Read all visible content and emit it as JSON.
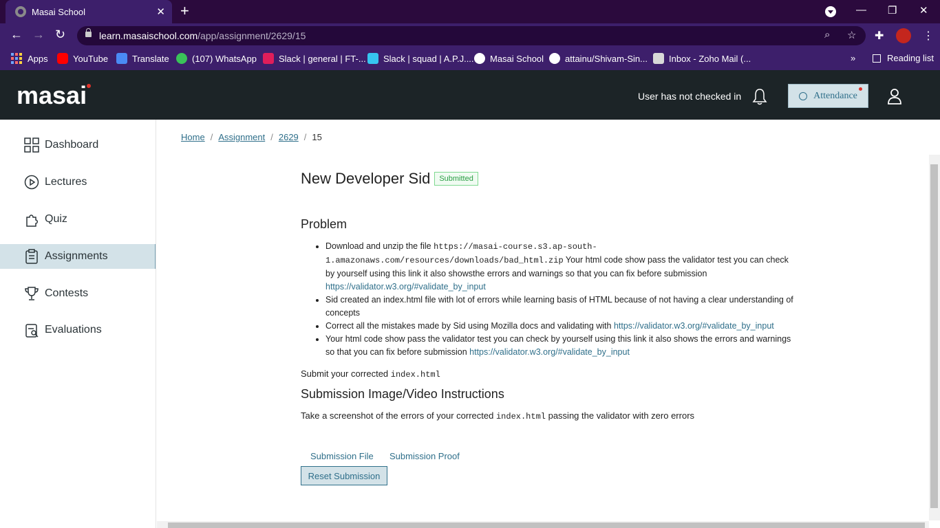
{
  "browser": {
    "tab_title": "Masai School",
    "url_host": "learn.masaischool.com",
    "url_path": "/app/assignment/2629/15",
    "bookmarks": [
      "Apps",
      "YouTube",
      "Translate",
      "(107) WhatsApp",
      "Slack | general | FT-...",
      "Slack | squad | A.P.J....",
      "Masai School",
      "attainu/Shivam-Sin...",
      "Inbox - Zoho Mail (..."
    ],
    "more": "»",
    "reading_list": "Reading list"
  },
  "header": {
    "logo": "masai",
    "checkin_status": "User has not checked in",
    "attendance_label": "Attendance"
  },
  "sidebar": {
    "items": [
      {
        "label": "Dashboard"
      },
      {
        "label": "Lectures"
      },
      {
        "label": "Quiz"
      },
      {
        "label": "Assignments"
      },
      {
        "label": "Contests"
      },
      {
        "label": "Evaluations"
      }
    ]
  },
  "breadcrumb": {
    "home": "Home",
    "assignment": "Assignment",
    "id": "2629",
    "current": "15",
    "sep": "/"
  },
  "assignment": {
    "title": "New Developer Sid",
    "status": "Submitted",
    "problem_heading": "Problem",
    "p1_text": "Download and unzip the file ",
    "p1_code": "https://masai-course.s3.ap-south-1.amazonaws.com/resources/downloads/bad_html.zip",
    "p1_rest": " Your html code show pass the validator test you can check by yourself using this link it also showsthe errors and warnings so that you can fix before submission",
    "validator_link": "https://validator.w3.org/#validate_by_input",
    "p2_text": "Sid created an index.html file with lot of errors while learning basis of HTML because of not having a clear understanding of concepts",
    "p3_text": "Correct all the mistakes made by Sid using Mozilla docs and validating with ",
    "p4_text": "Your html code show pass the validator test you can check by yourself using this link it also shows the errors and warnings so that you can fix before submission ",
    "submit_text": "Submit your corrected ",
    "file_code": "index.html",
    "instr_heading": "Submission Image/Video Instructions",
    "take_text": "Take a screenshot of the errors of your corrected ",
    "take_rest": " passing the validator with zero errors",
    "tab_file": "Submission File",
    "tab_proof": "Submission Proof",
    "reset_label": "Reset Submission"
  }
}
